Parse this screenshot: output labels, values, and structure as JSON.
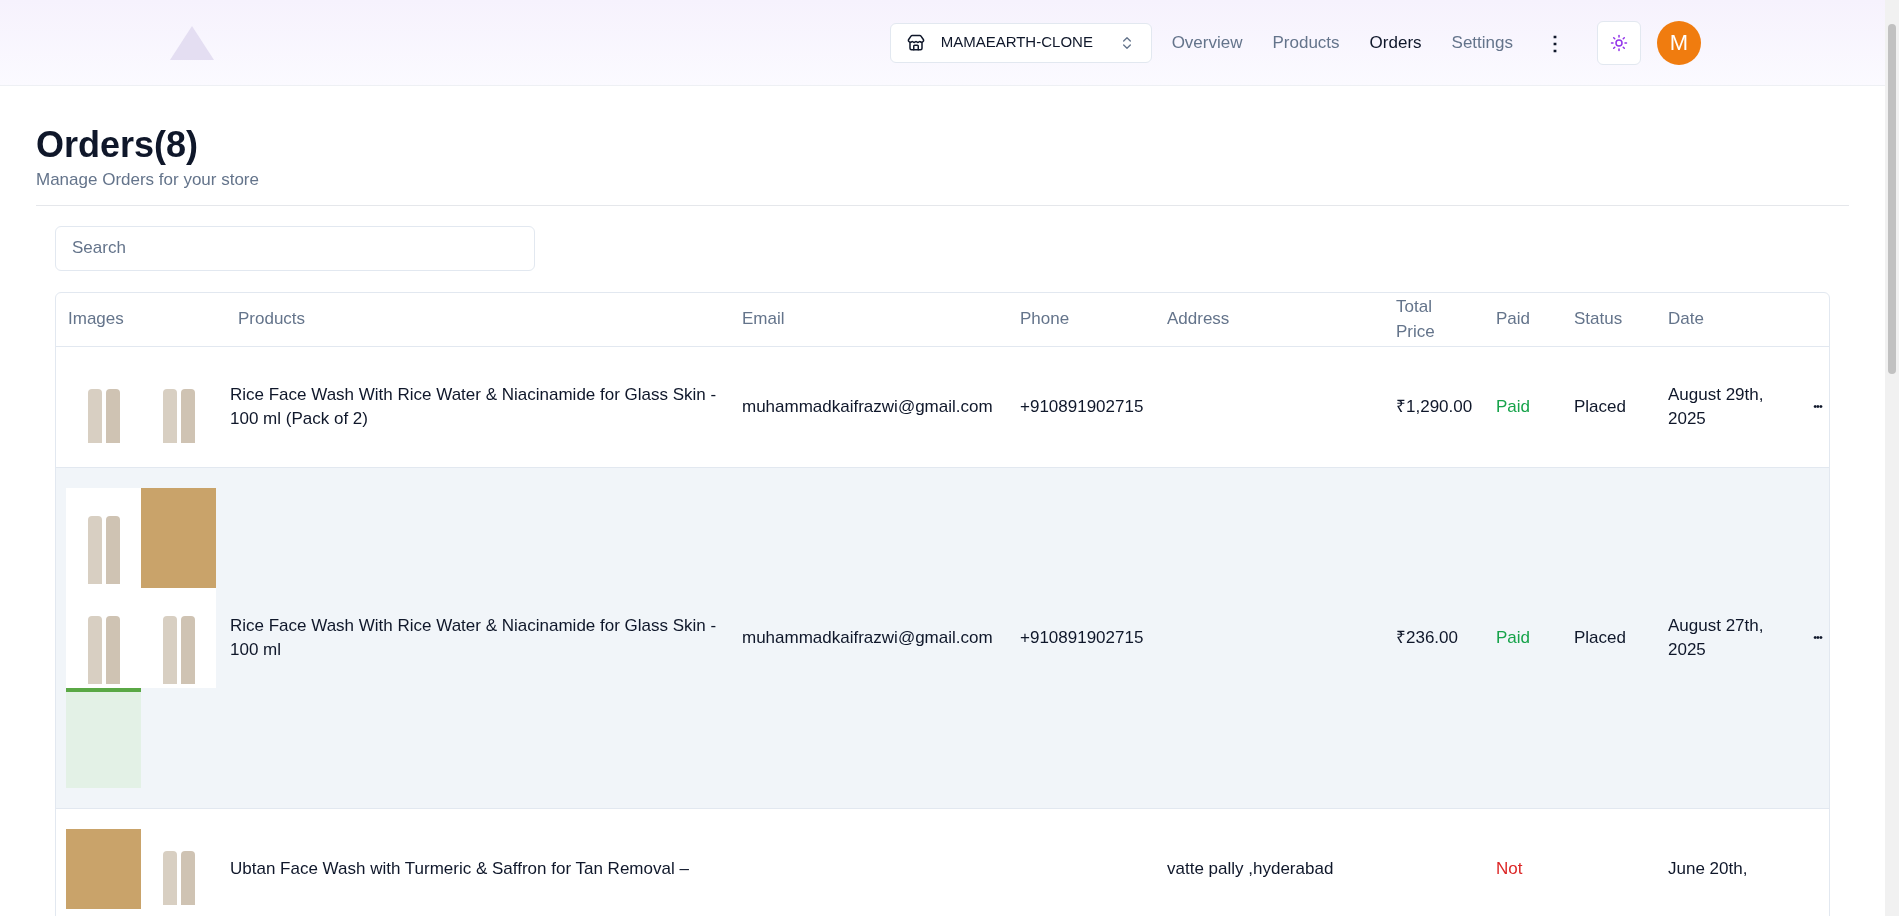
{
  "nav": {
    "store": "MAMAEARTH-CLONE",
    "links": [
      {
        "label": "Overview",
        "selected": false
      },
      {
        "label": "Products",
        "selected": false
      },
      {
        "label": "Orders",
        "selected": true
      },
      {
        "label": "Settings",
        "selected": false
      }
    ],
    "more": "⋮",
    "avatar": "M"
  },
  "heading": {
    "title": "Orders(8)",
    "subtitle": "Manage Orders for your store"
  },
  "search": {
    "placeholder": "Search"
  },
  "table": {
    "columns": [
      "Images",
      "Products",
      "Email",
      "Phone",
      "Address",
      "Total Price",
      "Paid",
      "Status",
      "Date"
    ],
    "rows": [
      {
        "highlighted": false,
        "images": [
          {
            "kind": "tube"
          },
          {
            "kind": "tube"
          }
        ],
        "product": "Rice Face Wash With Rice Water & Niacinamide for Glass Skin - 100 ml (Pack of 2)",
        "email": "muhammadkaifrazwi@gmail.com",
        "phone": "+910891902715",
        "total": "₹1,290.00",
        "paid": {
          "label": "Paid",
          "paid": true
        },
        "status": "Placed",
        "date": "August 29th, 2025",
        "actions": "•••"
      },
      {
        "highlighted": true,
        "images": [
          {
            "kind": "tube"
          },
          {
            "kind": "photo"
          },
          {
            "kind": "tube"
          },
          {
            "kind": "tube"
          },
          {
            "kind": "banner"
          }
        ],
        "product": "Rice Face Wash With Rice Water & Niacinamide for Glass Skin - 100 ml",
        "email": "muhammadkaifrazwi@gmail.com",
        "phone": "+910891902715",
        "total": "₹236.00",
        "paid": {
          "label": "Paid",
          "paid": true
        },
        "status": "Placed",
        "date": "August 27th, 2025",
        "actions": "•••"
      },
      {
        "highlighted": false,
        "images": [
          {
            "kind": "photo"
          },
          {
            "kind": "tube"
          }
        ],
        "product": "Ubtan Face Wash with Turmeric & Saffron for Tan Removal –",
        "address": "vatte pally ,hyderabad",
        "paid": {
          "label": "Not",
          "paid": false
        },
        "date": "June 20th,"
      }
    ]
  }
}
